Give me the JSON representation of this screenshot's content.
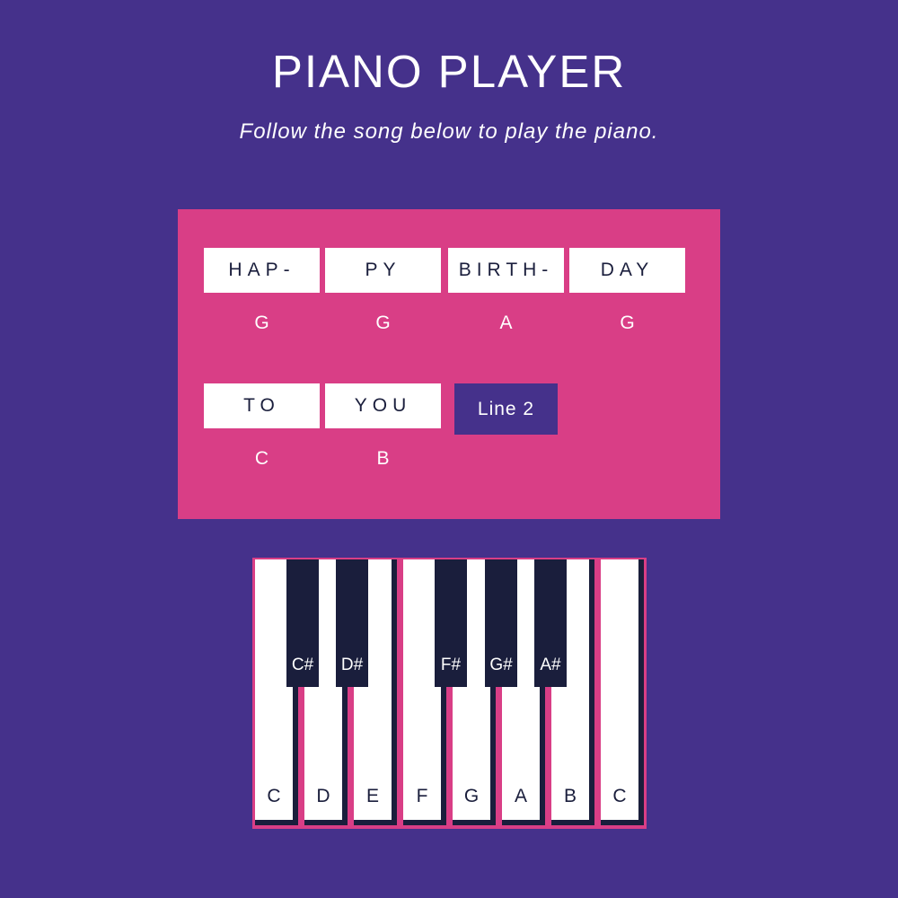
{
  "header": {
    "title": "PIANO PLAYER",
    "subtitle": "Follow the song below to play the piano."
  },
  "song": {
    "line1": [
      {
        "lyric": "HAP-",
        "note": "G"
      },
      {
        "lyric": "PY",
        "note": "G"
      },
      {
        "lyric": "BIRTH-",
        "note": "A"
      },
      {
        "lyric": "DAY",
        "note": "G"
      }
    ],
    "line2": [
      {
        "lyric": "TO",
        "note": "C"
      },
      {
        "lyric": "YOU",
        "note": "B"
      }
    ],
    "next_button_label": "Line 2"
  },
  "piano": {
    "white_keys": [
      "C",
      "D",
      "E",
      "F",
      "G",
      "A",
      "B",
      "C"
    ],
    "black_keys": [
      "C#",
      "D#",
      "F#",
      "G#",
      "A#"
    ]
  },
  "colors": {
    "background": "#45318b",
    "panel": "#d93e86",
    "key_dark": "#1a1e3c",
    "key_light": "#ffffff"
  }
}
